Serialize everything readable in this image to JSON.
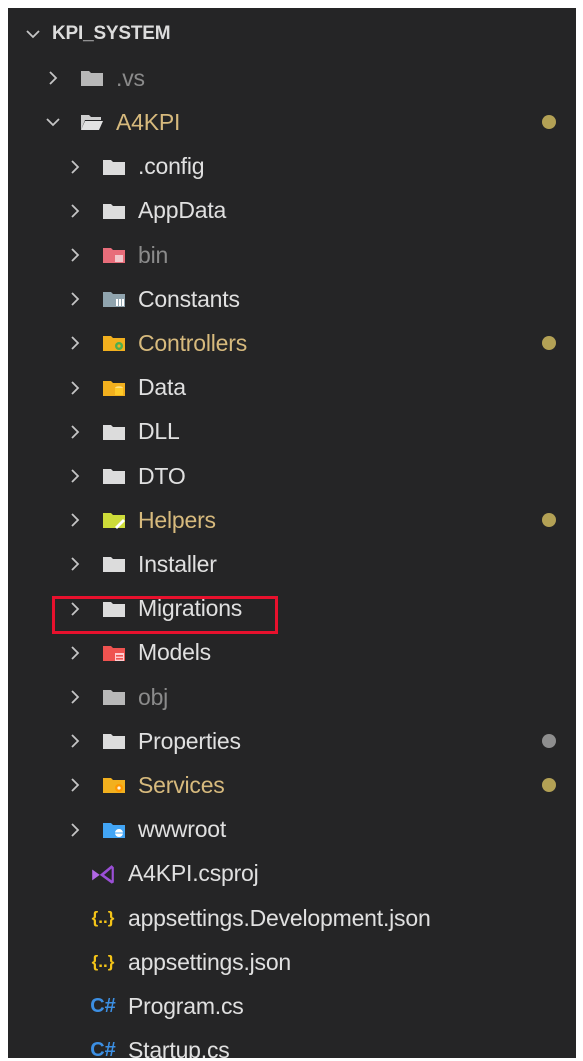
{
  "explorer": {
    "root_label": "KPI_SYSTEM",
    "items": [
      {
        "label": "KPI_SYSTEM",
        "kind": "root",
        "expanded": true
      },
      {
        "label": ".vs",
        "kind": "folder",
        "icon": "folder-icon",
        "status": "ignored"
      },
      {
        "label": "A4KPI",
        "kind": "folder",
        "icon": "folder-open-icon",
        "expanded": true,
        "status": "modified"
      },
      {
        "label": ".config",
        "kind": "folder",
        "icon": "folder-icon"
      },
      {
        "label": "AppData",
        "kind": "folder",
        "icon": "folder-icon"
      },
      {
        "label": "bin",
        "kind": "folder",
        "icon": "folder-bin-icon",
        "status": "ignored"
      },
      {
        "label": "Constants",
        "kind": "folder",
        "icon": "folder-constants-icon"
      },
      {
        "label": "Controllers",
        "kind": "folder",
        "icon": "folder-controllers-icon",
        "status": "modified"
      },
      {
        "label": "Data",
        "kind": "folder",
        "icon": "folder-data-icon"
      },
      {
        "label": "DLL",
        "kind": "folder",
        "icon": "folder-icon"
      },
      {
        "label": "DTO",
        "kind": "folder",
        "icon": "folder-icon"
      },
      {
        "label": "Helpers",
        "kind": "folder",
        "icon": "folder-helpers-icon",
        "status": "modified"
      },
      {
        "label": "Installer",
        "kind": "folder",
        "icon": "folder-icon"
      },
      {
        "label": "Migrations",
        "kind": "folder",
        "icon": "folder-icon",
        "highlighted": true
      },
      {
        "label": "Models",
        "kind": "folder",
        "icon": "folder-models-icon"
      },
      {
        "label": "obj",
        "kind": "folder",
        "icon": "folder-icon",
        "status": "ignored"
      },
      {
        "label": "Properties",
        "kind": "folder",
        "icon": "folder-icon",
        "status": "changed"
      },
      {
        "label": "Services",
        "kind": "folder",
        "icon": "folder-services-icon",
        "status": "modified"
      },
      {
        "label": "wwwroot",
        "kind": "folder",
        "icon": "folder-www-icon"
      },
      {
        "label": "A4KPI.csproj",
        "kind": "file",
        "icon": "visual-studio-icon"
      },
      {
        "label": "appsettings.Development.json",
        "kind": "file",
        "icon": "json-icon"
      },
      {
        "label": "appsettings.json",
        "kind": "file",
        "icon": "json-icon"
      },
      {
        "label": "Program.cs",
        "kind": "file",
        "icon": "csharp-icon"
      },
      {
        "label": "Startup.cs",
        "kind": "file",
        "icon": "csharp-icon"
      }
    ],
    "json_glyph": "{..}",
    "csharp_glyph": "C#"
  },
  "colors": {
    "background": "#252526",
    "text": "#e0e0e0",
    "ignored_text": "#8b8b8b",
    "modified_text": "#d7ba7d",
    "modified_dot": "#b3a155",
    "changed_dot": "#8e8e8e",
    "highlight_border": "#e8112d"
  }
}
